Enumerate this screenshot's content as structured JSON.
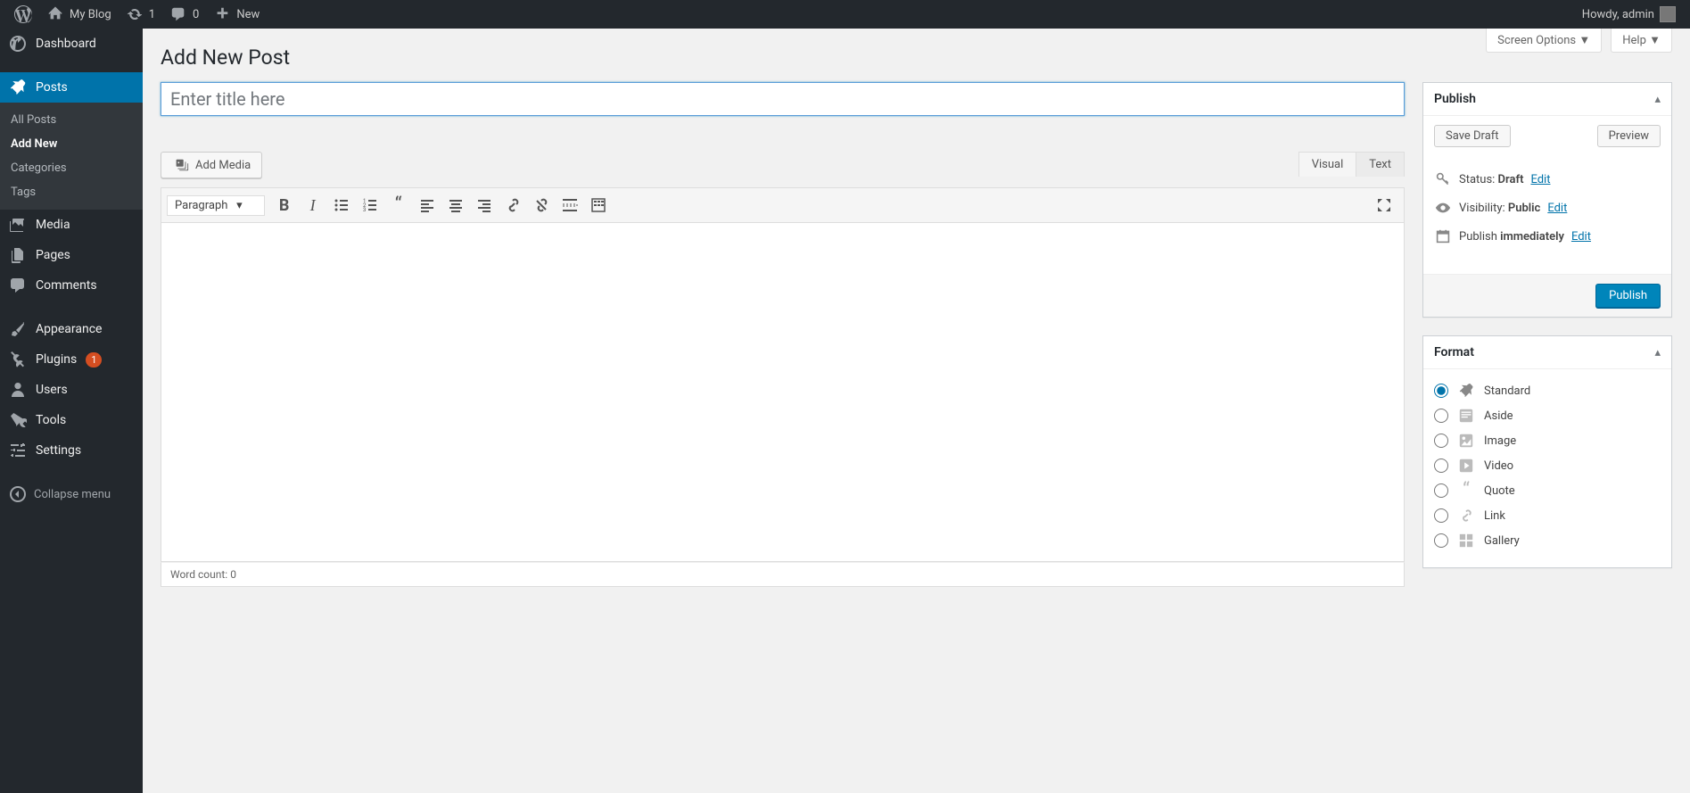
{
  "topbar": {
    "site_name": "My Blog",
    "updates_count": "1",
    "comments_count": "0",
    "new_label": "New",
    "howdy_prefix": "Howdy, ",
    "username": "admin"
  },
  "sidebar": {
    "dashboard": "Dashboard",
    "posts": "Posts",
    "posts_sub": {
      "all": "All Posts",
      "add_new": "Add New",
      "categories": "Categories",
      "tags": "Tags"
    },
    "media": "Media",
    "pages": "Pages",
    "comments": "Comments",
    "appearance": "Appearance",
    "plugins": "Plugins",
    "plugins_badge": "1",
    "users": "Users",
    "tools": "Tools",
    "settings": "Settings",
    "collapse": "Collapse menu"
  },
  "screen_tabs": {
    "screen_options": "Screen Options",
    "help": "Help"
  },
  "page": {
    "title": "Add New Post"
  },
  "editor": {
    "title_placeholder": "Enter title here",
    "add_media": "Add Media",
    "tab_visual": "Visual",
    "tab_text": "Text",
    "format_select": "Paragraph",
    "word_count_label": "Word count: ",
    "word_count": "0"
  },
  "publish": {
    "header": "Publish",
    "save_draft": "Save Draft",
    "preview": "Preview",
    "status_label": "Status: ",
    "status_value": "Draft",
    "visibility_label": "Visibility: ",
    "visibility_value": "Public",
    "publish_label": "Publish ",
    "publish_value": "immediately",
    "edit": "Edit",
    "publish_btn": "Publish"
  },
  "format": {
    "header": "Format",
    "options": {
      "standard": "Standard",
      "aside": "Aside",
      "image": "Image",
      "video": "Video",
      "quote": "Quote",
      "link": "Link",
      "gallery": "Gallery"
    }
  }
}
